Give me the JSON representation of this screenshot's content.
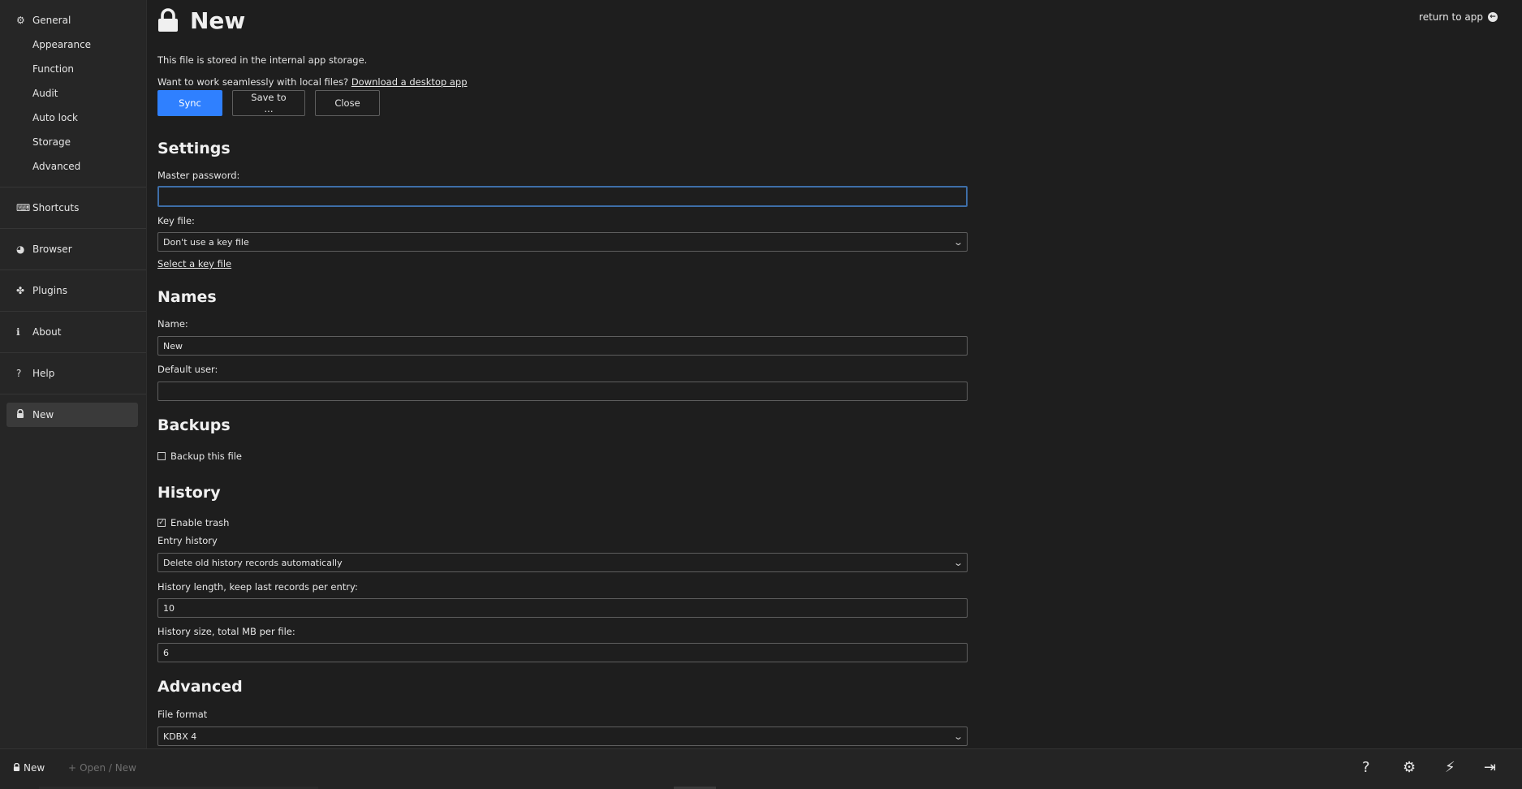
{
  "sidebar": {
    "general": "General",
    "sub": [
      "Appearance",
      "Function",
      "Audit",
      "Auto lock",
      "Storage",
      "Advanced"
    ],
    "shortcuts": "Shortcuts",
    "browser": "Browser",
    "plugins": "Plugins",
    "about": "About",
    "help": "Help",
    "file": "New"
  },
  "header": {
    "title": "New",
    "return_link": "return to app"
  },
  "info": {
    "storage_text": "This file is stored in the internal app storage.",
    "desktop_prompt": "Want to work seamlessly with local files?",
    "desktop_link": "Download a desktop app"
  },
  "buttons": {
    "sync": "Sync",
    "save_to": "Save to ...",
    "close": "Close"
  },
  "settings": {
    "heading": "Settings",
    "master_password_label": "Master password:",
    "master_password_value": "",
    "key_file_label": "Key file:",
    "key_file_value": "Don't use a key file",
    "select_key_file": "Select a key file"
  },
  "names": {
    "heading": "Names",
    "name_label": "Name:",
    "name_value": "New",
    "default_user_label": "Default user:",
    "default_user_value": ""
  },
  "backups": {
    "heading": "Backups",
    "backup_label": "Backup this file",
    "backup_checked": false
  },
  "history": {
    "heading": "History",
    "enable_trash_label": "Enable trash",
    "enable_trash_checked": true,
    "entry_history_label": "Entry history",
    "entry_history_value": "Delete old history records automatically",
    "length_label": "History length, keep last records per entry:",
    "length_value": "10",
    "size_label": "History size, total MB per file:",
    "size_value": "6"
  },
  "advanced": {
    "heading": "Advanced",
    "file_format_label": "File format",
    "file_format_value": "KDBX 4"
  },
  "footer": {
    "file": "New",
    "open_new": "Open / New"
  }
}
